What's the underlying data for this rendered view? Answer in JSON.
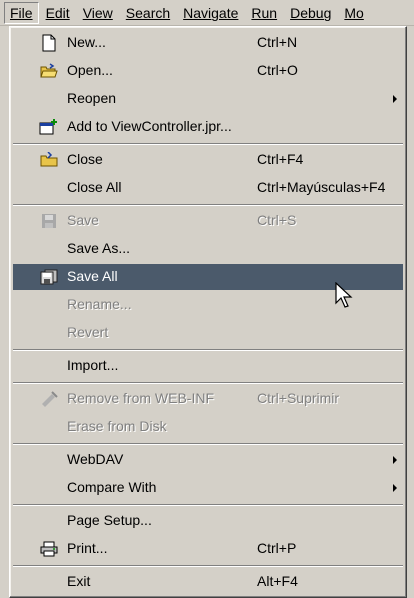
{
  "menubar": {
    "items": [
      "File",
      "Edit",
      "View",
      "Search",
      "Navigate",
      "Run",
      "Debug",
      "Mo"
    ]
  },
  "menu": {
    "new": {
      "label": "New...",
      "shortcut": "Ctrl+N"
    },
    "open": {
      "label": "Open...",
      "shortcut": "Ctrl+O"
    },
    "reopen": {
      "label": "Reopen"
    },
    "add_to": {
      "label": "Add to ViewController.jpr..."
    },
    "close": {
      "label": "Close",
      "shortcut": "Ctrl+F4"
    },
    "close_all": {
      "label": "Close All",
      "shortcut": "Ctrl+Mayúsculas+F4"
    },
    "save": {
      "label": "Save",
      "shortcut": "Ctrl+S"
    },
    "save_as": {
      "label": "Save As..."
    },
    "save_all": {
      "label": "Save All"
    },
    "rename": {
      "label": "Rename..."
    },
    "revert": {
      "label": "Revert"
    },
    "import": {
      "label": "Import..."
    },
    "remove_web_inf": {
      "label": "Remove from WEB-INF",
      "shortcut": "Ctrl+Suprimir"
    },
    "erase_disk": {
      "label": "Erase from Disk"
    },
    "webdav": {
      "label": "WebDAV"
    },
    "compare_with": {
      "label": "Compare With"
    },
    "page_setup": {
      "label": "Page Setup..."
    },
    "print": {
      "label": "Print...",
      "shortcut": "Ctrl+P"
    },
    "exit": {
      "label": "Exit",
      "shortcut": "Alt+F4"
    }
  },
  "colors": {
    "menu_bg": "#d4d0c8",
    "highlight": "#4b5a6b",
    "disabled_text": "#808080"
  }
}
